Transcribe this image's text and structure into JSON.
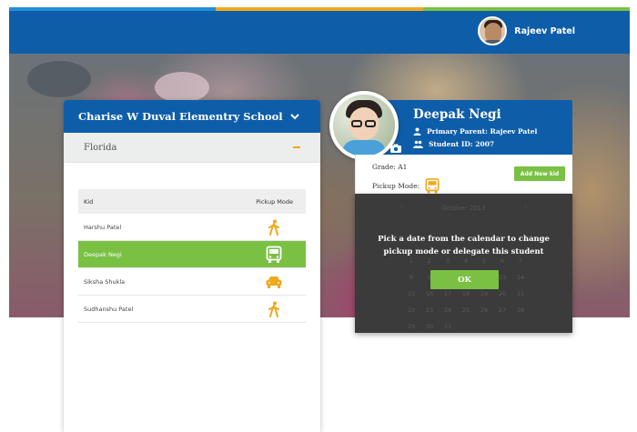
{
  "colors": {
    "brand_blue": "#0e5da9",
    "accent_green": "#7ac143",
    "pickup_yellow": "#f0a81c",
    "strip": [
      "#1f8fd6",
      "#f0a81c",
      "#7ac143"
    ]
  },
  "header": {
    "user_name": "Rajeev Patel",
    "avatar_icon": "user-photo"
  },
  "school_panel": {
    "school_name": "Charise W Duval Elementry School",
    "toggle_icon": "chevron-down-icon",
    "state": "Florida",
    "collapse_icon": "minus-icon",
    "table": {
      "col_kid": "Kid",
      "col_mode": "Pickup Mode",
      "rows": [
        {
          "name": "Harshu Patel",
          "mode_icon": "walk-icon",
          "active": false
        },
        {
          "name": "Deepak Negi",
          "mode_icon": "bus-icon",
          "active": true
        },
        {
          "name": "Siksha Shukla",
          "mode_icon": "car-icon",
          "active": false
        },
        {
          "name": "Sudhanshu Patel",
          "mode_icon": "walk-icon",
          "active": false
        }
      ]
    }
  },
  "student_card": {
    "name": "Deepak Negi",
    "primary_parent": "Primary Parent: Rajeev Patel",
    "student_id": "Student ID: 2007",
    "grade": "Grade: A1",
    "pickup_mode_label": "Pickup Mode:",
    "pickup_mode_icon": "bus-icon",
    "add_button": "Add New kid"
  },
  "calendar": {
    "month": "October 2013",
    "prev": "‹",
    "next": "›",
    "days": [
      "1",
      "2",
      "3",
      "4",
      "5",
      "6",
      "7",
      "8",
      "9",
      "10",
      "11",
      "12",
      "13",
      "14",
      "15",
      "16",
      "17",
      "18",
      "19",
      "20",
      "21",
      "22",
      "23",
      "24",
      "25",
      "26",
      "27",
      "28",
      "29",
      "30",
      "31"
    ],
    "message_line1": "Pick a date from the calendar to change",
    "message_line2": "pickup mode or delegate this student",
    "ok_label": "OK"
  }
}
